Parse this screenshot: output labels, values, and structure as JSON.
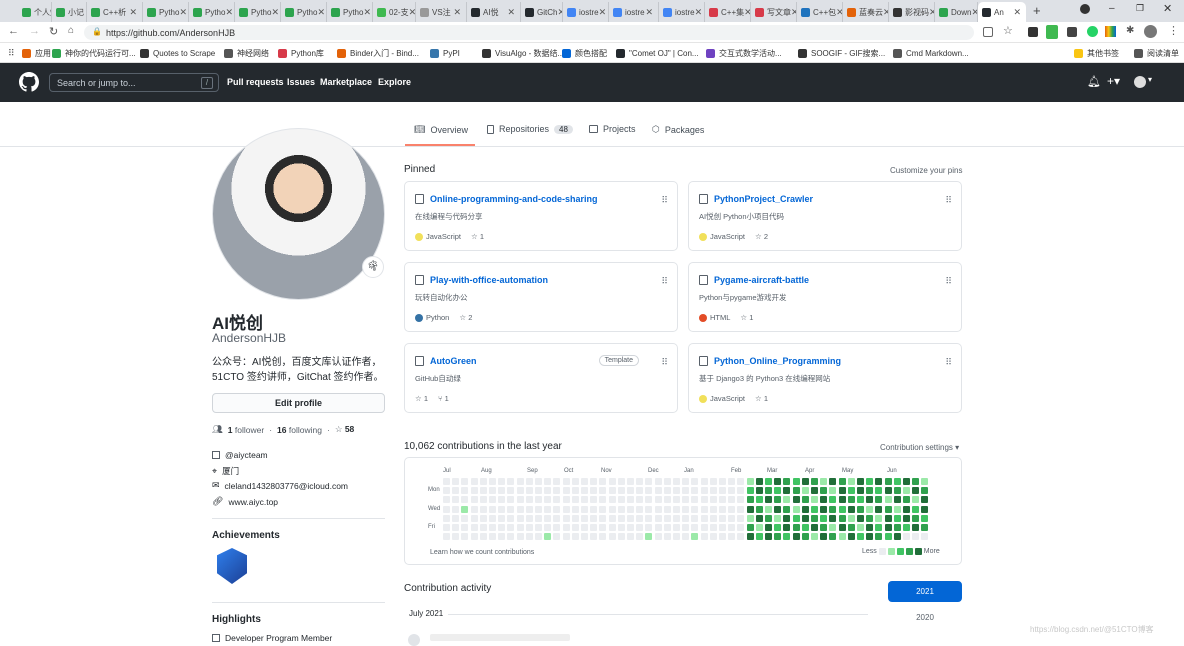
{
  "browser": {
    "tabs": [
      {
        "label": "个人知",
        "color": "#2da44e"
      },
      {
        "label": "小记 -",
        "color": "#2da44e"
      },
      {
        "label": "C++析",
        "color": "#2da44e"
      },
      {
        "label": "Pytho",
        "color": "#2da44e"
      },
      {
        "label": "Pytho",
        "color": "#2da44e"
      },
      {
        "label": "Pytho",
        "color": "#2da44e"
      },
      {
        "label": "Pytho",
        "color": "#2da44e"
      },
      {
        "label": "Pytho",
        "color": "#2da44e"
      },
      {
        "label": "02-支",
        "color": "#3fb950"
      },
      {
        "label": "VS注",
        "color": "#999"
      },
      {
        "label": "AI悦",
        "color": "#24292e"
      },
      {
        "label": "GitCh",
        "color": "#24292e"
      },
      {
        "label": "iostre",
        "color": "#4285f4"
      },
      {
        "label": "iostre",
        "color": "#4285f4"
      },
      {
        "label": "iostre",
        "color": "#4285f4"
      },
      {
        "label": "C++集",
        "color": "#d73a49"
      },
      {
        "label": "写文章",
        "color": "#d73a49"
      },
      {
        "label": "C++包",
        "color": "#1e73be"
      },
      {
        "label": "蓝奏云",
        "color": "#e36209"
      },
      {
        "label": "影视码",
        "color": "#333"
      },
      {
        "label": "Down",
        "color": "#2da44e"
      },
      {
        "label": "An",
        "color": "#24292e"
      }
    ],
    "new_tab": "+",
    "url": "https://github.com/AndersonHJB",
    "bookmarks": [
      {
        "label": "应用",
        "color": "#e36209"
      },
      {
        "label": "神你的代码运行可...",
        "color": "#2da44e"
      },
      {
        "label": "Quotes to Scrape",
        "color": "#333"
      },
      {
        "label": "神经网络",
        "color": "#555"
      },
      {
        "label": "Python库",
        "color": "#d73a49"
      },
      {
        "label": "Binder入门 - Bind...",
        "color": "#e36209"
      },
      {
        "label": "PyPI",
        "color": "#3776ab"
      },
      {
        "label": "VisuAlgo - 数据结...",
        "color": "#333"
      },
      {
        "label": "颜色搭配",
        "color": "#0366d6"
      },
      {
        "label": "\"Comet OJ\" | Con...",
        "color": "#24292e"
      },
      {
        "label": "交互式数学活动...",
        "color": "#6f42c1"
      },
      {
        "label": "SOOGIF - GIF搜索...",
        "color": "#333"
      },
      {
        "label": "Cmd Markdown...",
        "color": "#555"
      },
      {
        "label": "其他书签",
        "color": "#f9c513"
      },
      {
        "label": "阅读清单",
        "color": "#555"
      }
    ]
  },
  "github": {
    "search_placeholder": "Search or jump to...",
    "search_key": "/",
    "nav": [
      "Pull requests",
      "Issues",
      "Marketplace",
      "Explore"
    ],
    "profile_tabs": [
      {
        "label": "Overview",
        "count": ""
      },
      {
        "label": "Repositories",
        "count": "48"
      },
      {
        "label": "Projects",
        "count": ""
      },
      {
        "label": "Packages",
        "count": ""
      }
    ],
    "name": "AI悦创",
    "username": "AndersonHJB",
    "bio_line1": "公众号：AI悦创，百度文库认证作者，",
    "bio_line2": "51CTO 签约讲师，GitChat 签约作者。",
    "edit_profile": "Edit profile",
    "followers": "1",
    "followers_label": "follower",
    "following": "16",
    "following_label": "following",
    "stars": "58",
    "org": "@aiycteam",
    "location": "厦门",
    "email": "cleland1432803776@icloud.com",
    "website": "www.aiyc.top",
    "achievements_title": "Achievements",
    "highlights_title": "Highlights",
    "highlight_item": "Developer Program Member",
    "pinned_title": "Pinned",
    "customize": "Customize your pins",
    "pins": [
      {
        "name": "Online-programming-and-code-sharing",
        "desc": "在线编程与代码分享",
        "lang": "JavaScript",
        "lang_color": "#f1e05a",
        "stars": "1",
        "forks": "",
        "template": ""
      },
      {
        "name": "PythonProject_Crawler",
        "desc": "AI悦创 Python小项目代码",
        "lang": "JavaScript",
        "lang_color": "#f1e05a",
        "stars": "2",
        "forks": "",
        "template": ""
      },
      {
        "name": "Play-with-office-automation",
        "desc": "玩转自动化办公",
        "lang": "Python",
        "lang_color": "#3572A5",
        "stars": "2",
        "forks": "",
        "template": ""
      },
      {
        "name": "Pygame-aircraft-battle",
        "desc": "Python与pygame游戏开发",
        "lang": "HTML",
        "lang_color": "#e34c26",
        "stars": "1",
        "forks": "",
        "template": ""
      },
      {
        "name": "AutoGreen",
        "desc": "GitHub自动绿",
        "lang": "",
        "lang_color": "",
        "stars": "1",
        "forks": "1",
        "template": "Template"
      },
      {
        "name": "Python_Online_Programming",
        "desc": "基于 Django3 的 Python3 在线编程网站",
        "lang": "JavaScript",
        "lang_color": "#f1e05a",
        "stars": "1",
        "forks": "",
        "template": ""
      }
    ],
    "contrib_title": "10,062 contributions in the last year",
    "contrib_settings": "Contribution settings ▾",
    "months": [
      "Jul",
      "Aug",
      "Sep",
      "Oct",
      "Nov",
      "Dec",
      "Jan",
      "Feb",
      "Mar",
      "Apr",
      "May",
      "Jun"
    ],
    "days": [
      "Mon",
      "Wed",
      "Fri"
    ],
    "learn": "Learn how we count contributions",
    "less": "Less",
    "more": "More",
    "activity_title": "Contribution activity",
    "activity_month": "July 2021",
    "years": [
      "2021",
      "2020"
    ],
    "colors": {
      "l0": "#ebedf0",
      "l1": "#9be9a8",
      "l2": "#40c463",
      "l3": "#30a14e",
      "l4": "#216e39",
      "link": "#0366d6"
    }
  },
  "watermark": "https://blog.csdn.net/@51CTO博客"
}
